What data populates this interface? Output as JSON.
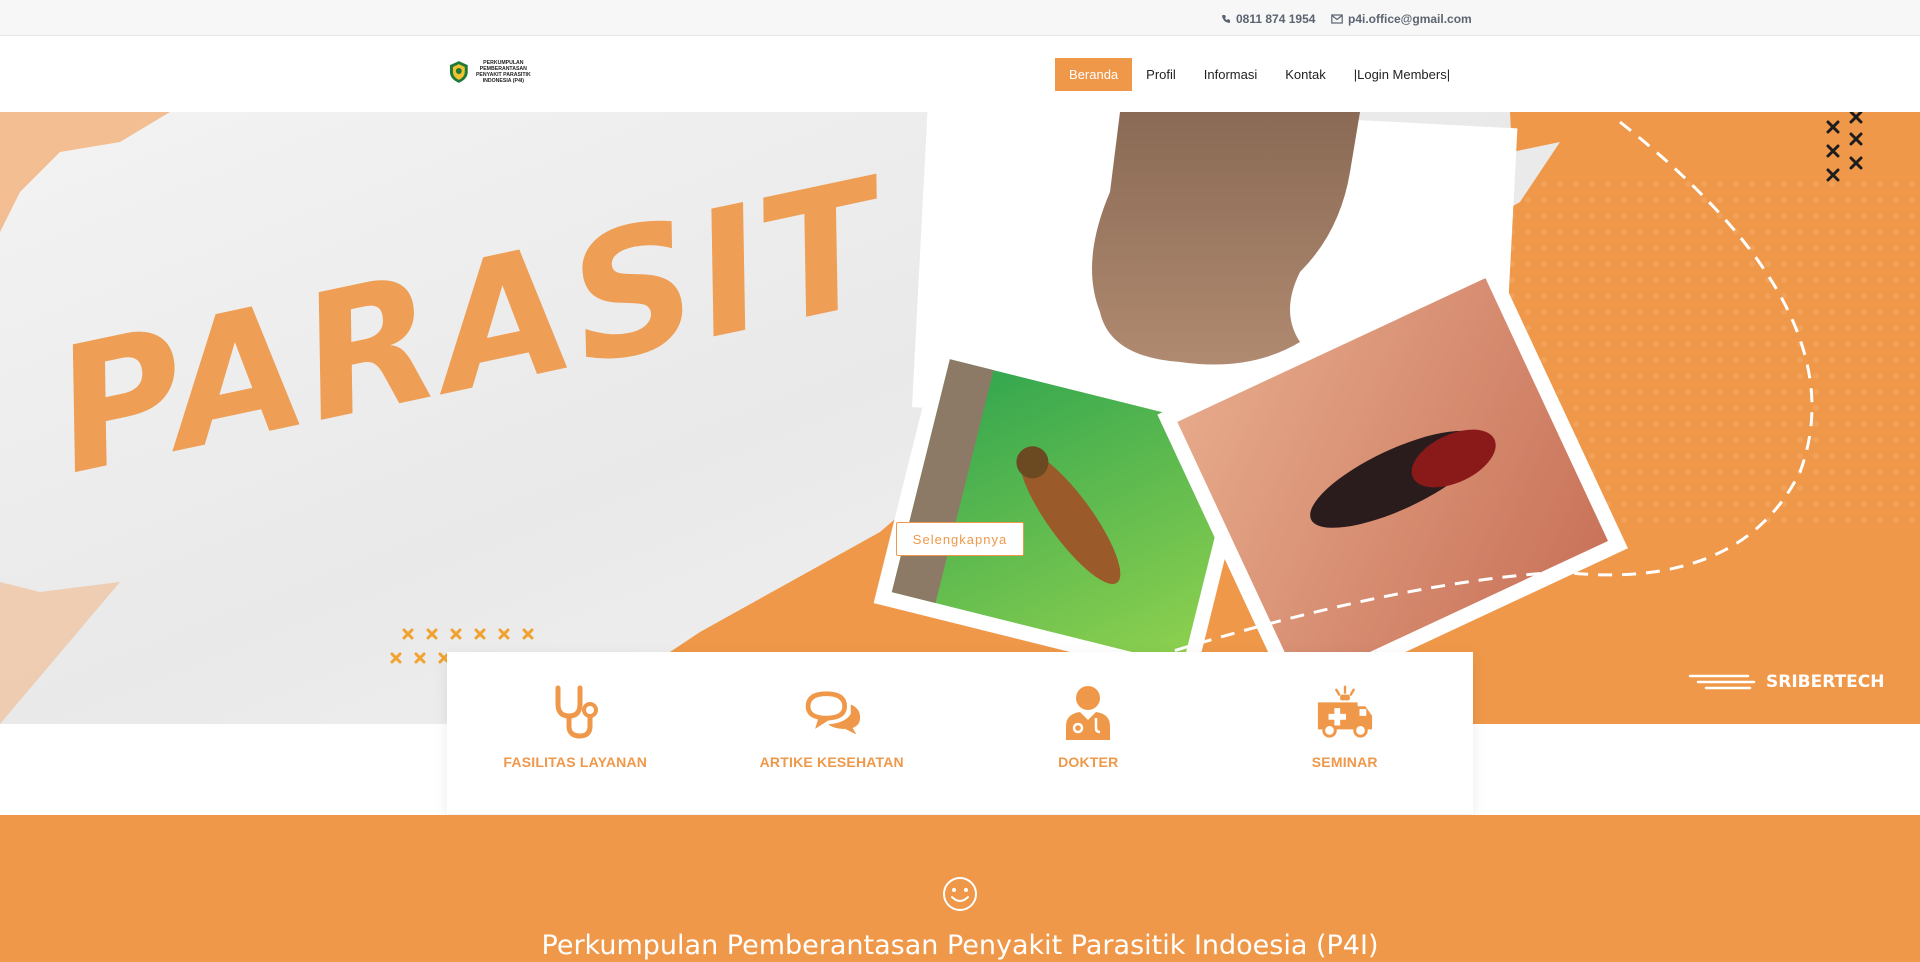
{
  "topbar": {
    "phone": "0811 874 1954",
    "email": "p4i.office@gmail.com"
  },
  "logo": {
    "text": "PERKUMPULAN PEMBERANTASAN PENYAKIT PARASITIK INDONESIA (P4I)"
  },
  "nav": {
    "items": [
      {
        "label": "Beranda",
        "active": true
      },
      {
        "label": "Profil",
        "active": false
      },
      {
        "label": "Informasi",
        "active": false
      },
      {
        "label": "Kontak",
        "active": false
      },
      {
        "label": "|Login Members|",
        "active": false
      }
    ]
  },
  "hero": {
    "title": "PARASIT",
    "cta_label": "Selengkapnya",
    "watermark": "SRIBERTECH"
  },
  "features": [
    {
      "label": "FASILITAS LAYANAN",
      "icon": "stethoscope-icon"
    },
    {
      "label": "ARTIKE KESEHATAN",
      "icon": "chat-bubbles-icon"
    },
    {
      "label": "DOKTER",
      "icon": "doctor-icon"
    },
    {
      "label": "SEMINAR",
      "icon": "ambulance-icon"
    }
  ],
  "about": {
    "icon": "smile-icon",
    "heading": "Perkumpulan Pemberantasan Penyakit Parasitik Indoesia (P4I)"
  },
  "colors": {
    "accent": "#ef9849",
    "topbar_text": "#5b6470"
  }
}
